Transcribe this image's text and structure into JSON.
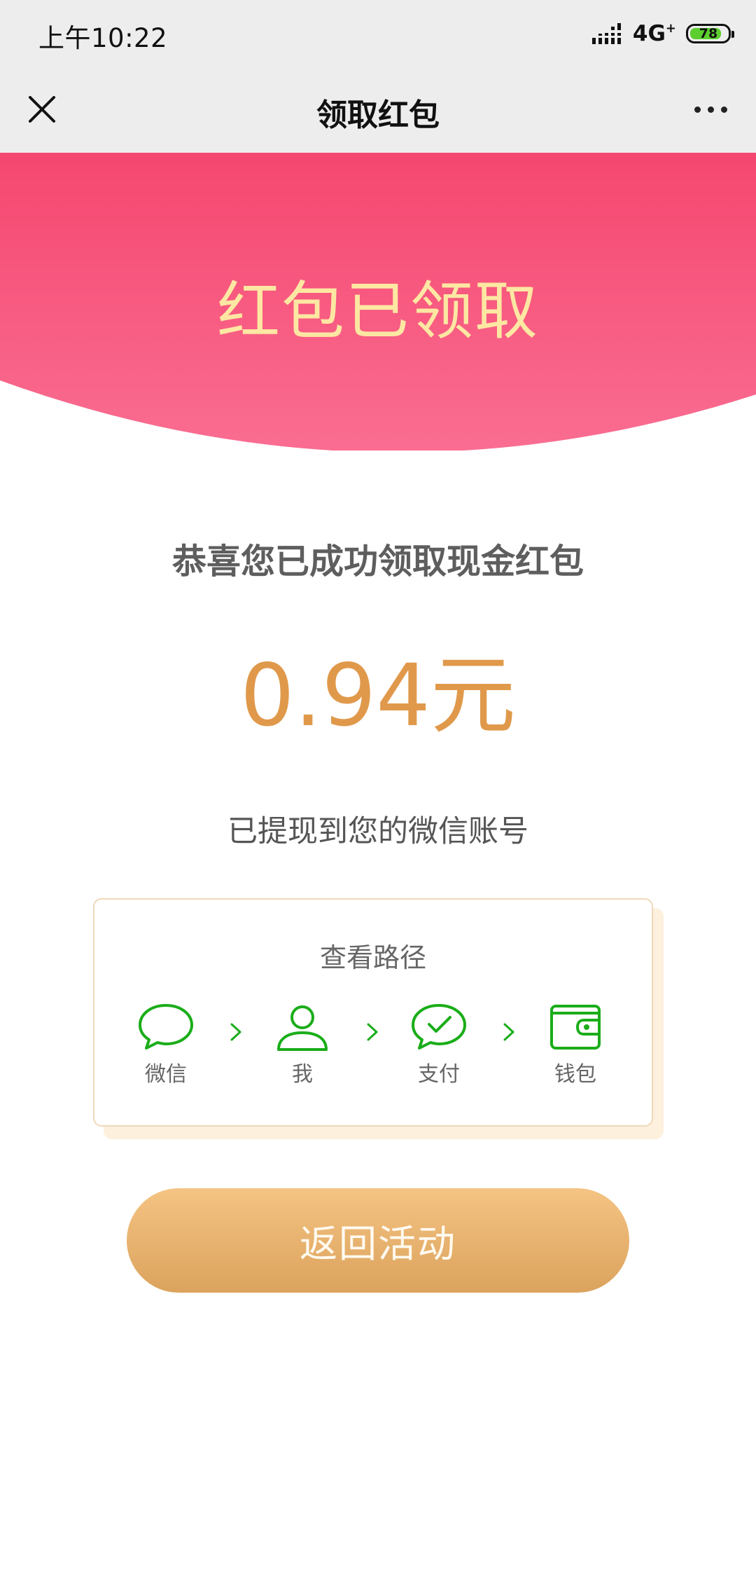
{
  "status_bar": {
    "time": "上午10:22",
    "network": "4G",
    "battery_level": "78"
  },
  "nav": {
    "title": "领取红包"
  },
  "header": {
    "title": "红包已领取"
  },
  "main": {
    "congrats": "恭喜您已成功领取现金红包",
    "amount": "0.94元",
    "withdrawn_note": "已提现到您的微信账号"
  },
  "path_card": {
    "title": "查看路径",
    "steps": [
      {
        "label": "微信",
        "icon": "chat-bubble-icon"
      },
      {
        "label": "我",
        "icon": "user-icon"
      },
      {
        "label": "支付",
        "icon": "payment-check-icon"
      },
      {
        "label": "钱包",
        "icon": "wallet-icon"
      }
    ]
  },
  "return_button": {
    "label": "返回活动"
  },
  "colors": {
    "header_red": "#f75b81",
    "gold_text": "#fde7a2",
    "amount_orange": "#e0994b",
    "wechat_green": "#1aad19",
    "button_gold": "#e6b06c"
  }
}
